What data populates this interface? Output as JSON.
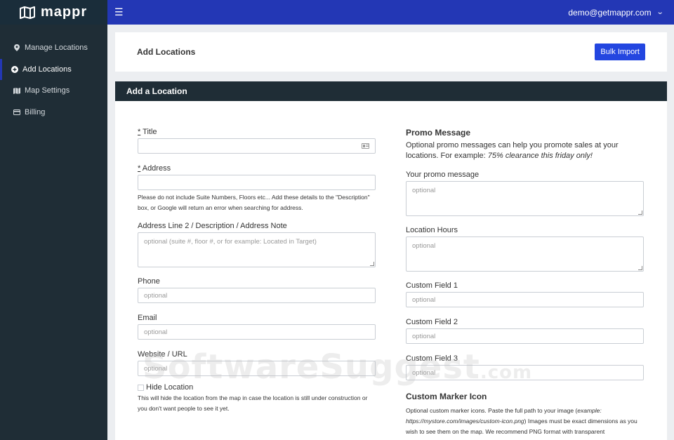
{
  "brand": {
    "name": "mappr"
  },
  "topbar": {
    "user_email": "demo@getmappr.com"
  },
  "sidebar": {
    "items": [
      {
        "label": "Manage Locations",
        "icon": "map-pin-icon",
        "active": false
      },
      {
        "label": "Add Locations",
        "icon": "plus-circle-icon",
        "active": true
      },
      {
        "label": "Map Settings",
        "icon": "map-icon",
        "active": false
      },
      {
        "label": "Billing",
        "icon": "credit-card-icon",
        "active": false
      }
    ]
  },
  "header": {
    "title": "Add Locations",
    "bulk_import_label": "Bulk Import"
  },
  "form": {
    "heading": "Add a Location",
    "title_field": {
      "req": "*",
      "label": " Title",
      "value": ""
    },
    "address_field": {
      "req": "*",
      "label": " Address",
      "value": "",
      "help": "Please do not include Suite Numbers, Floors etc... Add these details to the \"Description\" box, or Google will return an error when searching for address."
    },
    "address2_field": {
      "label": "Address Line 2 / Description / Address Note",
      "placeholder": "optional (suite #, floor #, or for example: Located in Target)"
    },
    "phone_field": {
      "label": "Phone",
      "placeholder": "optional"
    },
    "email_field": {
      "label": "Email",
      "placeholder": "optional"
    },
    "website_field": {
      "label": "Website / URL",
      "placeholder": "optional"
    },
    "hide_location": {
      "label": "Hide Location",
      "help": "This will hide the location from the map in case the location is still under construction or you don't want people to see it yet."
    },
    "promo": {
      "title": "Promo Message",
      "text_plain": "Optional promo messages can help you promote sales at your locations. For example: ",
      "text_example": "75% clearance this friday only!",
      "field_label": "Your promo message",
      "placeholder": "optional"
    },
    "hours_field": {
      "label": "Location Hours",
      "placeholder": "optional"
    },
    "custom1": {
      "label": "Custom Field 1",
      "placeholder": "optional"
    },
    "custom2": {
      "label": "Custom Field 2",
      "placeholder": "optional"
    },
    "custom3": {
      "label": "Custom Field 3",
      "placeholder": "optional"
    },
    "marker": {
      "title": "Custom Marker Icon",
      "text_a": "Optional custom marker icons. Paste the full path to your image (",
      "text_example": "example: https://mystore.com/images/custom-icon.png",
      "text_b": ") Images must be exact dimensions as you wish to see them on the map. We recommend PNG format with transparent"
    }
  },
  "watermark": {
    "text": "SoftwareSuggest",
    "suffix": ".com"
  },
  "colors": {
    "topbar": "#2337b5",
    "sidebar": "#1f2d36",
    "primary_button": "#2346e0"
  }
}
